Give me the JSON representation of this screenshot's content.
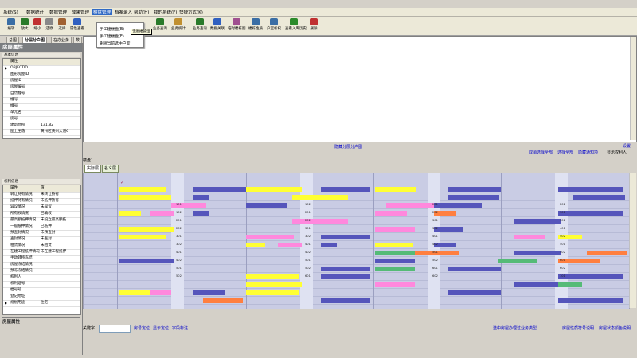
{
  "menubar": {
    "items": [
      "系统(S)",
      "数据统计",
      "数据管理",
      "成果管理",
      "楼盘管理",
      "档案录入",
      "帮助(H)",
      "我的系统(F)",
      "快捷方式(K)"
    ],
    "active_index": 4
  },
  "toolbar": {
    "buttons": [
      "编辑",
      "放大",
      "缩小",
      "还原",
      "选择",
      "属性查看",
      "",
      "",
      "",
      "",
      "",
      "",
      "",
      "",
      "业务查询",
      "业务统计",
      "业务查询",
      "数据关联",
      "临时楼栋图",
      "楼栋性质",
      "户室析权",
      "",
      "查看入库历史",
      "删除"
    ]
  },
  "dropdown": {
    "items": [
      "手工建楼盘(B)",
      "手工建楼盘(E)",
      "删除当前选中户室"
    ]
  },
  "tooltip": "无图楼管理",
  "left_tabs": [
    "总图",
    "分层分户图",
    "在办业务",
    "数"
  ],
  "left_selected_tab": 1,
  "house_panel": {
    "title": "房屋属性",
    "subheader": "基本信息",
    "header_col": "属性",
    "rows": [
      {
        "k": "OBJECTID",
        "v": ""
      },
      {
        "k": "图形房屋ID",
        "v": ""
      },
      {
        "k": "房屋ID",
        "v": ""
      },
      {
        "k": "房屋编号",
        "v": ""
      },
      {
        "k": "自然幢号",
        "v": ""
      },
      {
        "k": "幢号",
        "v": ""
      },
      {
        "k": "幢号",
        "v": ""
      },
      {
        "k": "单元名",
        "v": ""
      },
      {
        "k": "房号",
        "v": ""
      },
      {
        "k": "建筑面积",
        "v": "131.82"
      },
      {
        "k": "图上坐落",
        "v": "黄州区黄州大道6"
      }
    ]
  },
  "status_panel": {
    "subheader": "权利信息",
    "header": [
      "属性",
      "值"
    ],
    "rows": [
      {
        "k": "转让持有情况",
        "v": "未转让持有"
      },
      {
        "k": "抵押持有情况",
        "v": "未抵押持有"
      },
      {
        "k": "异议情况",
        "v": "未异议"
      },
      {
        "k": "所有权情况",
        "v": "已确权"
      },
      {
        "k": "最高额抵押情况",
        "v": "未设立最高额抵"
      },
      {
        "k": "一般抵押情况",
        "v": "已抵押"
      },
      {
        "k": "预查封情况",
        "v": "未预查封"
      },
      {
        "k": "查封情况",
        "v": "未查封"
      },
      {
        "k": "租赁情况",
        "v": "未租赁"
      },
      {
        "k": "在建工程抵押情况",
        "v": "未在建工程抵押"
      },
      {
        "k": "手动转移冻结",
        "v": ""
      },
      {
        "k": "房屋冻结情况",
        "v": ""
      },
      {
        "k": "预冻冻结情况",
        "v": ""
      },
      {
        "k": "权利人",
        "v": ""
      },
      {
        "k": "权利证号",
        "v": ""
      },
      {
        "k": "档号号",
        "v": ""
      },
      {
        "k": "登记地址",
        "v": ""
      },
      {
        "k": "规划用途",
        "v": "住宅"
      }
    ]
  },
  "bottom_panel_title": "房屋属性",
  "hide_link": "隐藏分层分户图",
  "right_links": [
    "设置",
    "取消选择全部",
    "选择全部",
    "隐藏通知项",
    "显示权利人"
  ],
  "floor_label": "楼盘1",
  "floor_tabs": [
    "实际层",
    "名义层"
  ],
  "unit_codes": [
    "101",
    "102",
    "201",
    "202",
    "301",
    "302",
    "401",
    "402",
    "501",
    "502",
    "601",
    "602"
  ],
  "status_bar": {
    "search_label": "关键字",
    "search_value": "",
    "links_left": [
      "房号定位",
      "显示定位",
      "字段标注"
    ],
    "links_right": [
      "选中房屋办理过业务类型",
      "房屋性质符号说明",
      "房屋状态颜色说明"
    ]
  },
  "colors": {
    "yellow": "#ffff33",
    "pink": "#ff88dd",
    "blue": "#5555bb",
    "green": "#55bb77",
    "orange": "#ff7f40",
    "lavender": "#c9cce4"
  }
}
